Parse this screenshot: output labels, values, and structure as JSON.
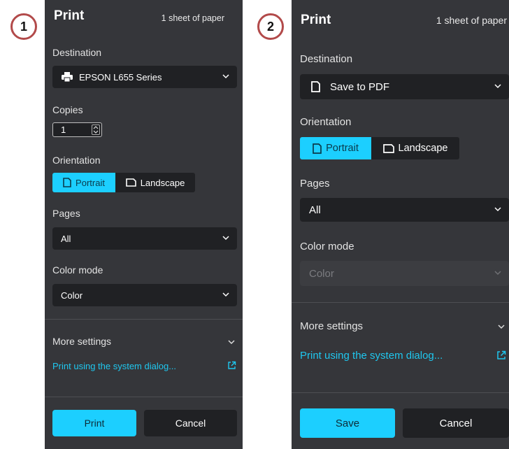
{
  "badges": {
    "one": "1",
    "two": "2"
  },
  "panel1": {
    "title": "Print",
    "sheets": "1 sheet of paper",
    "destination_label": "Destination",
    "destination_value": "EPSON L655 Series",
    "copies_label": "Copies",
    "copies_value": "1",
    "orientation_label": "Orientation",
    "portrait": "Portrait",
    "landscape": "Landscape",
    "pages_label": "Pages",
    "pages_value": "All",
    "color_label": "Color mode",
    "color_value": "Color",
    "more_settings": "More settings",
    "system_dialog": "Print using the system dialog...",
    "primary_button": "Print",
    "cancel_button": "Cancel"
  },
  "panel2": {
    "title": "Print",
    "sheets": "1 sheet of paper",
    "destination_label": "Destination",
    "destination_value": "Save to PDF",
    "orientation_label": "Orientation",
    "portrait": "Portrait",
    "landscape": "Landscape",
    "pages_label": "Pages",
    "pages_value": "All",
    "color_label": "Color mode",
    "color_value": "Color",
    "more_settings": "More settings",
    "system_dialog": "Print using the system dialog...",
    "primary_button": "Save",
    "cancel_button": "Cancel"
  },
  "colors": {
    "panel_bg": "#35363a",
    "field_bg": "#202124",
    "accent": "#1ccfff",
    "link": "#1fc7ef",
    "badge_border": "#b24a4a"
  },
  "icons": {
    "printer": "printer-icon",
    "document": "document-icon",
    "portrait": "portrait-page-icon",
    "landscape": "landscape-page-icon",
    "chevron": "chevron-down-icon",
    "external": "external-link-icon"
  }
}
